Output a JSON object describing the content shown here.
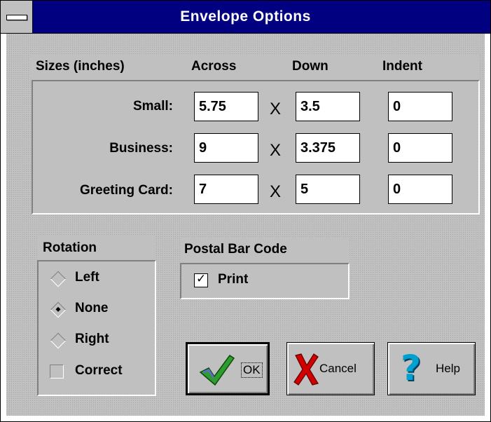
{
  "window": {
    "title": "Envelope Options"
  },
  "sizes": {
    "header": "Sizes (inches)",
    "col_across": "Across",
    "col_down": "Down",
    "col_indent": "Indent",
    "separator": "X",
    "rows": [
      {
        "label": "Small:",
        "across": "5.75",
        "down": "3.5",
        "indent": "0"
      },
      {
        "label": "Business:",
        "across": "9",
        "down": "3.375",
        "indent": "0"
      },
      {
        "label": "Greeting Card:",
        "across": "7",
        "down": "5",
        "indent": "0"
      }
    ]
  },
  "rotation": {
    "header": "Rotation",
    "options": [
      {
        "label": "Left",
        "selected": false
      },
      {
        "label": "None",
        "selected": true
      },
      {
        "label": "Right",
        "selected": false
      }
    ],
    "correct_label": "Correct",
    "correct_checked": false
  },
  "postal": {
    "header": "Postal Bar Code",
    "print_label": "Print",
    "print_checked": true,
    "check_glyph": "✓"
  },
  "buttons": {
    "ok": "OK",
    "cancel": "Cancel",
    "help": "Help"
  },
  "icons": {
    "ok": "green-checkmark-icon",
    "cancel": "red-x-icon",
    "help": "blue-question-mark-icon"
  },
  "colors": {
    "titlebar": "#000080",
    "face": "#c0c0c0",
    "ok_icon": "#2e9c2e",
    "cancel_icon": "#d00000",
    "help_icon": "#00a0d0"
  }
}
